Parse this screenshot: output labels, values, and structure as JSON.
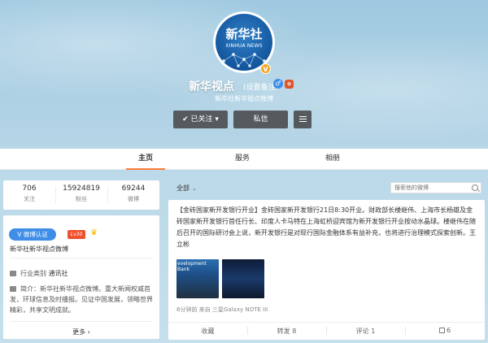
{
  "profile": {
    "avatar_title": "新华社",
    "avatar_subtitle": "XINHUA NEWS",
    "verified_mark": "V",
    "name": "新华视点",
    "remark": "(设置备注)",
    "gender_symbol": "♂",
    "badge_symbol": "✿",
    "description": "新华社新华视点微博",
    "buttons": {
      "follow": "✔ 已关注 ▾",
      "message": "私信"
    }
  },
  "tabs": [
    {
      "label": "主页",
      "active": true
    },
    {
      "label": "服务"
    },
    {
      "label": "相册"
    }
  ],
  "stats": [
    {
      "value": "706",
      "label": "关注"
    },
    {
      "value": "15924819",
      "label": "粉丝"
    },
    {
      "value": "69244",
      "label": "微博"
    }
  ],
  "info": {
    "verify_label": "V 微博认证",
    "level": "Lv30",
    "vip_symbol": "♛",
    "verify_text": "新华社新华视点微博",
    "industry_label": "行业类别",
    "industry_value": "通讯社",
    "intro_label": "简介：",
    "intro_text": "新华社新华视点微博。重大新闻权威首发，环球信息及时播报。见证中国发展，领略世界精彩，共享文明成就。",
    "more": "更多 ›"
  },
  "feed": {
    "filter_label": "全部",
    "filter_caret": "⌄",
    "search_placeholder": "搜索他的微博"
  },
  "post": {
    "text": "【金砖国家新开发银行开业】金砖国家新开发银行21日8:30开业。财政部长楼继伟、上海市长杨雄及金砖国家新开发银行首任行长、印度人卡马特在上海虹桥迎宾馆为新开发银行开业按动水晶球。楼继伟在随后召开的国际研讨会上说，新开发银行是对现行国际金融体系有益补充，也将进行治理模式探索创新。王立彬",
    "image1_caption": "evelopment Bank",
    "meta": "6分钟前 来自 三星Galaxy NOTE III",
    "actions": {
      "favorite": "收藏",
      "repost": "转发 8",
      "comment": "评论 1",
      "like": "6"
    }
  }
}
